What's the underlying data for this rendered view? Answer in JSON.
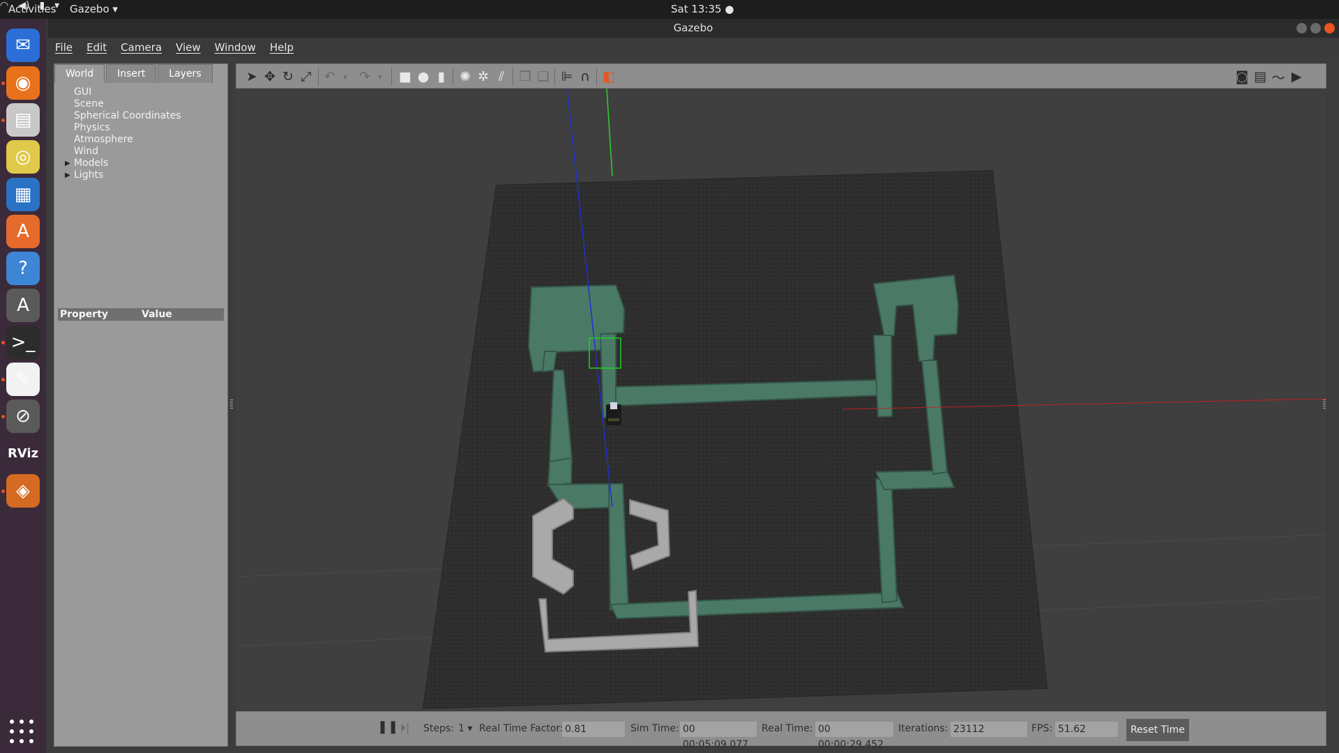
{
  "topbar": {
    "activities": "Activities",
    "app_menu": "Gazebo ▾",
    "clock": "Sat 13:35 ●",
    "tray_icons": [
      "wifi-icon",
      "volume-icon",
      "battery-icon",
      "power-menu-icon"
    ]
  },
  "window": {
    "title": "Gazebo"
  },
  "dock": {
    "items": [
      {
        "name": "thunderbird-icon",
        "glyph": "✉",
        "bg": "#2b6fd6",
        "running": false
      },
      {
        "name": "firefox-icon",
        "glyph": "◉",
        "bg": "#e8721c",
        "running": true
      },
      {
        "name": "files-icon",
        "glyph": "▤",
        "bg": "#c8c8c8",
        "running": true
      },
      {
        "name": "rhythmbox-icon",
        "glyph": "◎",
        "bg": "#e0c84a",
        "running": false
      },
      {
        "name": "libreoffice-writer-icon",
        "glyph": "▦",
        "bg": "#2a73c4",
        "running": false
      },
      {
        "name": "software-center-icon",
        "glyph": "A",
        "bg": "#e66a2c",
        "running": false
      },
      {
        "name": "help-icon",
        "glyph": "?",
        "bg": "#3d86d6",
        "running": false
      },
      {
        "name": "software-updater-icon",
        "glyph": "A",
        "bg": "#5a5a5a",
        "running": false
      },
      {
        "name": "terminal-icon",
        "glyph": ">_",
        "bg": "#2c2c2c",
        "running": true
      },
      {
        "name": "text-editor-icon",
        "glyph": "✎",
        "bg": "#f2f2f2",
        "running": true
      },
      {
        "name": "no-entry-app-icon",
        "glyph": "⊘",
        "bg": "#5a5a5a",
        "running": true
      },
      {
        "name": "rviz-icon",
        "glyph": "RViz",
        "bg": "#3b2a3a",
        "running": false
      },
      {
        "name": "gazebo-icon",
        "glyph": "◈",
        "bg": "#5a5a5a",
        "running": true
      }
    ]
  },
  "menubar": {
    "items": [
      "File",
      "Edit",
      "Camera",
      "View",
      "Window",
      "Help"
    ]
  },
  "left_panel": {
    "tabs": [
      "World",
      "Insert",
      "Layers"
    ],
    "active_tab": "World",
    "tree": [
      {
        "label": "GUI",
        "expandable": false
      },
      {
        "label": "Scene",
        "expandable": false
      },
      {
        "label": "Spherical Coordinates",
        "expandable": false
      },
      {
        "label": "Physics",
        "expandable": false
      },
      {
        "label": "Atmosphere",
        "expandable": false
      },
      {
        "label": "Wind",
        "expandable": false
      },
      {
        "label": "Models",
        "expandable": true
      },
      {
        "label": "Lights",
        "expandable": true
      }
    ],
    "property_header": {
      "property": "Property",
      "value": "Value"
    }
  },
  "toolbar": {
    "tools": [
      "select-arrow-icon",
      "translate-icon",
      "rotate-icon",
      "scale-icon",
      "undo-icon",
      "undo-dropdown-icon",
      "redo-icon",
      "redo-dropdown-icon",
      "box-shape-icon",
      "sphere-shape-icon",
      "cylinder-shape-icon",
      "point-light-icon",
      "spot-light-icon",
      "directional-light-icon",
      "copy-icon",
      "paste-icon",
      "align-icon",
      "snap-magnet-icon",
      "view-angle-icon"
    ],
    "right_tools": [
      "screenshot-icon",
      "log-icon",
      "plot-icon",
      "record-video-icon"
    ]
  },
  "status": {
    "steps_label": "Steps:",
    "steps_value": "1",
    "rtf_label": "Real Time Factor:",
    "rtf_value": "0.81",
    "sim_time_label": "Sim Time:",
    "sim_time_value": "00 00:05:09.077",
    "real_time_label": "Real Time:",
    "real_time_value": "00 00:00:29.452",
    "iterations_label": "Iterations:",
    "iterations_value": "23112",
    "fps_label": "FPS:",
    "fps_value": "51.62",
    "reset_label": "Reset Time"
  },
  "colors": {
    "wall_green": "#4a7a66",
    "wall_grey": "#a9a9a9",
    "ground": "#2e2e2e",
    "accent": "#e95420"
  }
}
